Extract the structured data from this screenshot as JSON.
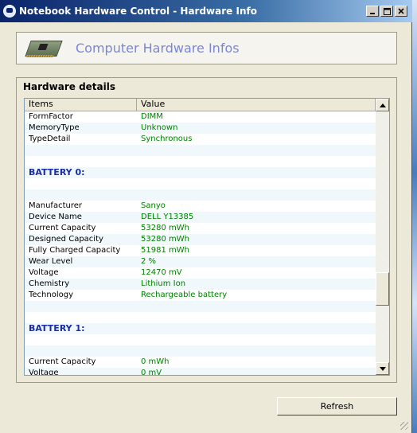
{
  "window": {
    "title": "Notebook Hardware Control - Hardware Info",
    "buttons": [
      "minimize",
      "maximize",
      "close"
    ]
  },
  "header": {
    "title": "Computer Hardware Infos",
    "icon": "pci-card-icon"
  },
  "details": {
    "group_label": "Hardware details",
    "columns": [
      "Items",
      "Value"
    ],
    "rows": [
      {
        "type": "item",
        "item": "FormFactor",
        "value": "DIMM"
      },
      {
        "type": "item",
        "item": "MemoryType",
        "value": "Unknown"
      },
      {
        "type": "item",
        "item": "TypeDetail",
        "value": "Synchronous"
      },
      {
        "type": "spacer"
      },
      {
        "type": "spacer"
      },
      {
        "type": "section",
        "label": "BATTERY 0:"
      },
      {
        "type": "spacer"
      },
      {
        "type": "spacer"
      },
      {
        "type": "item",
        "item": "Manufacturer",
        "value": "Sanyo"
      },
      {
        "type": "item",
        "item": "Device Name",
        "value": "DELL Y13385"
      },
      {
        "type": "item",
        "item": "Current Capacity",
        "value": "53280 mWh"
      },
      {
        "type": "item",
        "item": "Designed Capacity",
        "value": "53280 mWh"
      },
      {
        "type": "item",
        "item": "Fully Charged Capacity",
        "value": "51981 mWh"
      },
      {
        "type": "item",
        "item": "Wear Level",
        "value": "2 %"
      },
      {
        "type": "item",
        "item": "Voltage",
        "value": "12470 mV"
      },
      {
        "type": "item",
        "item": "Chemistry",
        "value": "Lithium Ion"
      },
      {
        "type": "item",
        "item": "Technology",
        "value": "Rechargeable battery"
      },
      {
        "type": "spacer"
      },
      {
        "type": "spacer"
      },
      {
        "type": "section",
        "label": "BATTERY 1:"
      },
      {
        "type": "spacer"
      },
      {
        "type": "spacer"
      },
      {
        "type": "item",
        "item": "Current Capacity",
        "value": "0 mWh"
      },
      {
        "type": "item",
        "item": "Voltage",
        "value": "0 mV"
      },
      {
        "type": "spacer"
      }
    ],
    "scroll_position": 0.74
  },
  "footer": {
    "refresh_label": "Refresh"
  }
}
